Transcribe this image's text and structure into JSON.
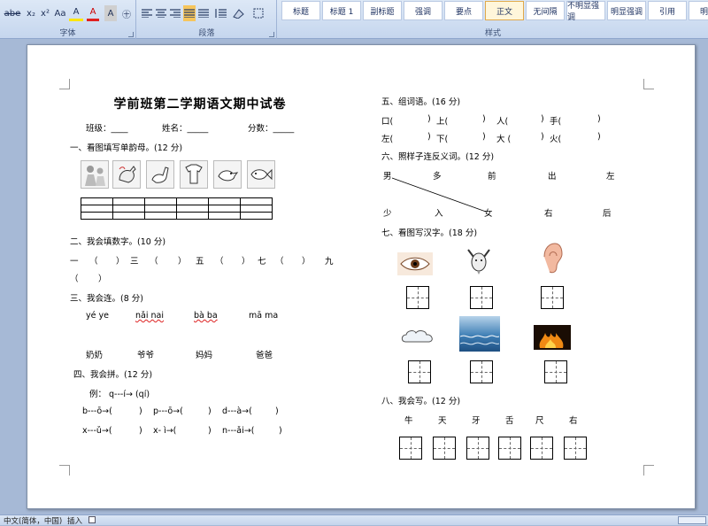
{
  "ribbon": {
    "font_group_label": "字体",
    "paragraph_group_label": "段落",
    "styles_group_label": "样式",
    "font_tools": [
      "abe",
      "x₂",
      "x²",
      "Aa",
      "A",
      "A",
      "A",
      "㊉"
    ],
    "styles": [
      "标题",
      "标题 1",
      "副标题",
      "强调",
      "要点",
      "正文",
      "无间隔",
      "不明显强调",
      "明显强调",
      "引用",
      "明显"
    ],
    "active_style_index": 5
  },
  "doc": {
    "title": "学前班第二学期语文期中试卷",
    "info": {
      "class": "班级：____",
      "name": "姓名：_____",
      "score": "分数：_____"
    },
    "q1": "一、看图填写单韵母。(12 分)",
    "q2": "二、我会填数字。(10 分)",
    "q2_row1": [
      "一",
      "（",
      "）",
      "三",
      "（",
      "）",
      "五",
      "（",
      "）",
      "七",
      "（",
      "）",
      "九"
    ],
    "q2_row2": [
      "（",
      "）"
    ],
    "q3": "三、我会连。(8 分)",
    "q3_pinyin": [
      "yé ye",
      "nǎi nai",
      "bà ba",
      "mā ma"
    ],
    "q3_words": [
      "奶奶",
      "爷爷",
      "妈妈",
      "爸爸"
    ],
    "q4": "四、我会拼。(12 分)",
    "q4_example": "例：  q---í→ (qí)",
    "q4_row1": [
      "b---ō→(",
      ")",
      "p---ō→(",
      ")",
      "d---à→(",
      ")"
    ],
    "q4_row2": [
      "x---ǔ→(",
      ")",
      "x-  ì→(",
      ")",
      "n---ǎi→(",
      ")"
    ],
    "q5": "五、组词语。(16 分)",
    "q5_row1": [
      "口(",
      ")",
      "上(",
      ")",
      "人(",
      ")",
      "手(",
      ")"
    ],
    "q5_row2": [
      "左(",
      ")",
      "下(",
      ")",
      "大 (",
      ")",
      "火(",
      ")"
    ],
    "q6": "六、照样子连反义词。(12 分)",
    "q6_top": [
      "男",
      "多",
      "前",
      "出",
      "左"
    ],
    "q6_bottom": [
      "少",
      "入",
      "女",
      "右",
      "后"
    ],
    "q7": "七、看图写汉字。(18 分)",
    "q7_images": [
      "eye-picture",
      "goat-picture",
      "ear-picture",
      "cloud-picture",
      "water-picture",
      "fire-picture"
    ],
    "q8": "八、我会写。(12 分)",
    "q8_chars": [
      "牛",
      "天",
      "牙",
      "舌",
      "尺",
      "右"
    ]
  },
  "status": {
    "language": "中文(简体，中国)",
    "insert": "插入"
  }
}
